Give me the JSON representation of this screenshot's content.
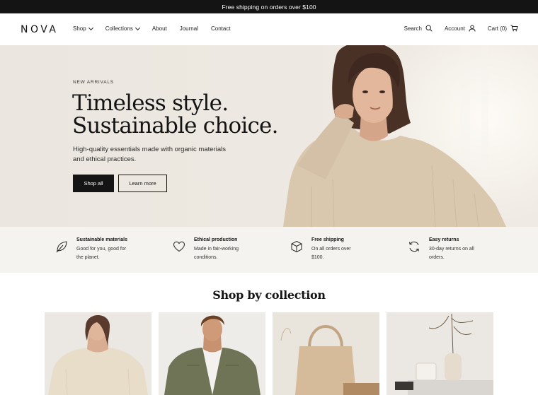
{
  "announcement": "Free shipping on orders over $100",
  "header": {
    "logo": "NOVA",
    "nav": [
      {
        "label": "Shop",
        "has_dropdown": true
      },
      {
        "label": "Collections",
        "has_dropdown": true
      },
      {
        "label": "About",
        "has_dropdown": false
      },
      {
        "label": "Journal",
        "has_dropdown": false
      },
      {
        "label": "Contact",
        "has_dropdown": false
      }
    ],
    "search_label": "Search",
    "account_label": "Account",
    "cart_label": "Cart (0)",
    "icons": {
      "search": "search-icon",
      "account": "user-icon",
      "cart": "cart-icon"
    }
  },
  "hero": {
    "eyebrow": "NEW ARRIVALS",
    "title_line1": "Timeless style.",
    "title_line2": "Sustainable choice.",
    "subtitle_line1": "High-quality essentials made with organic materials",
    "subtitle_line2": "and ethical practices.",
    "primary_cta": "Shop all",
    "secondary_cta": "Learn more"
  },
  "features": [
    {
      "icon": "leaf-icon",
      "title": "Sustainable materials",
      "desc_line1": "Good for you, good for",
      "desc_line2": "the planet."
    },
    {
      "icon": "heart-icon",
      "title": "Ethical production",
      "desc_line1": "Made in fair-working",
      "desc_line2": "conditions."
    },
    {
      "icon": "box-icon",
      "title": "Free shipping",
      "desc_line1": "On all orders over",
      "desc_line2": "$100."
    },
    {
      "icon": "returns-icon",
      "title": "Easy returns",
      "desc_line1": "30-day returns on all",
      "desc_line2": "orders."
    }
  ],
  "collections": {
    "title": "Shop by collection",
    "cards": [
      {
        "image": "woman-in-knit-sweater"
      },
      {
        "image": "man-in-olive-jacket"
      },
      {
        "image": "canvas-tote-bag"
      },
      {
        "image": "vase-and-candle-home-decor"
      }
    ]
  },
  "colors": {
    "announcement_bg": "#141414",
    "primary_button": "#141414",
    "hero_bg": "#ebe6df",
    "features_bg": "#f5f3ef"
  }
}
